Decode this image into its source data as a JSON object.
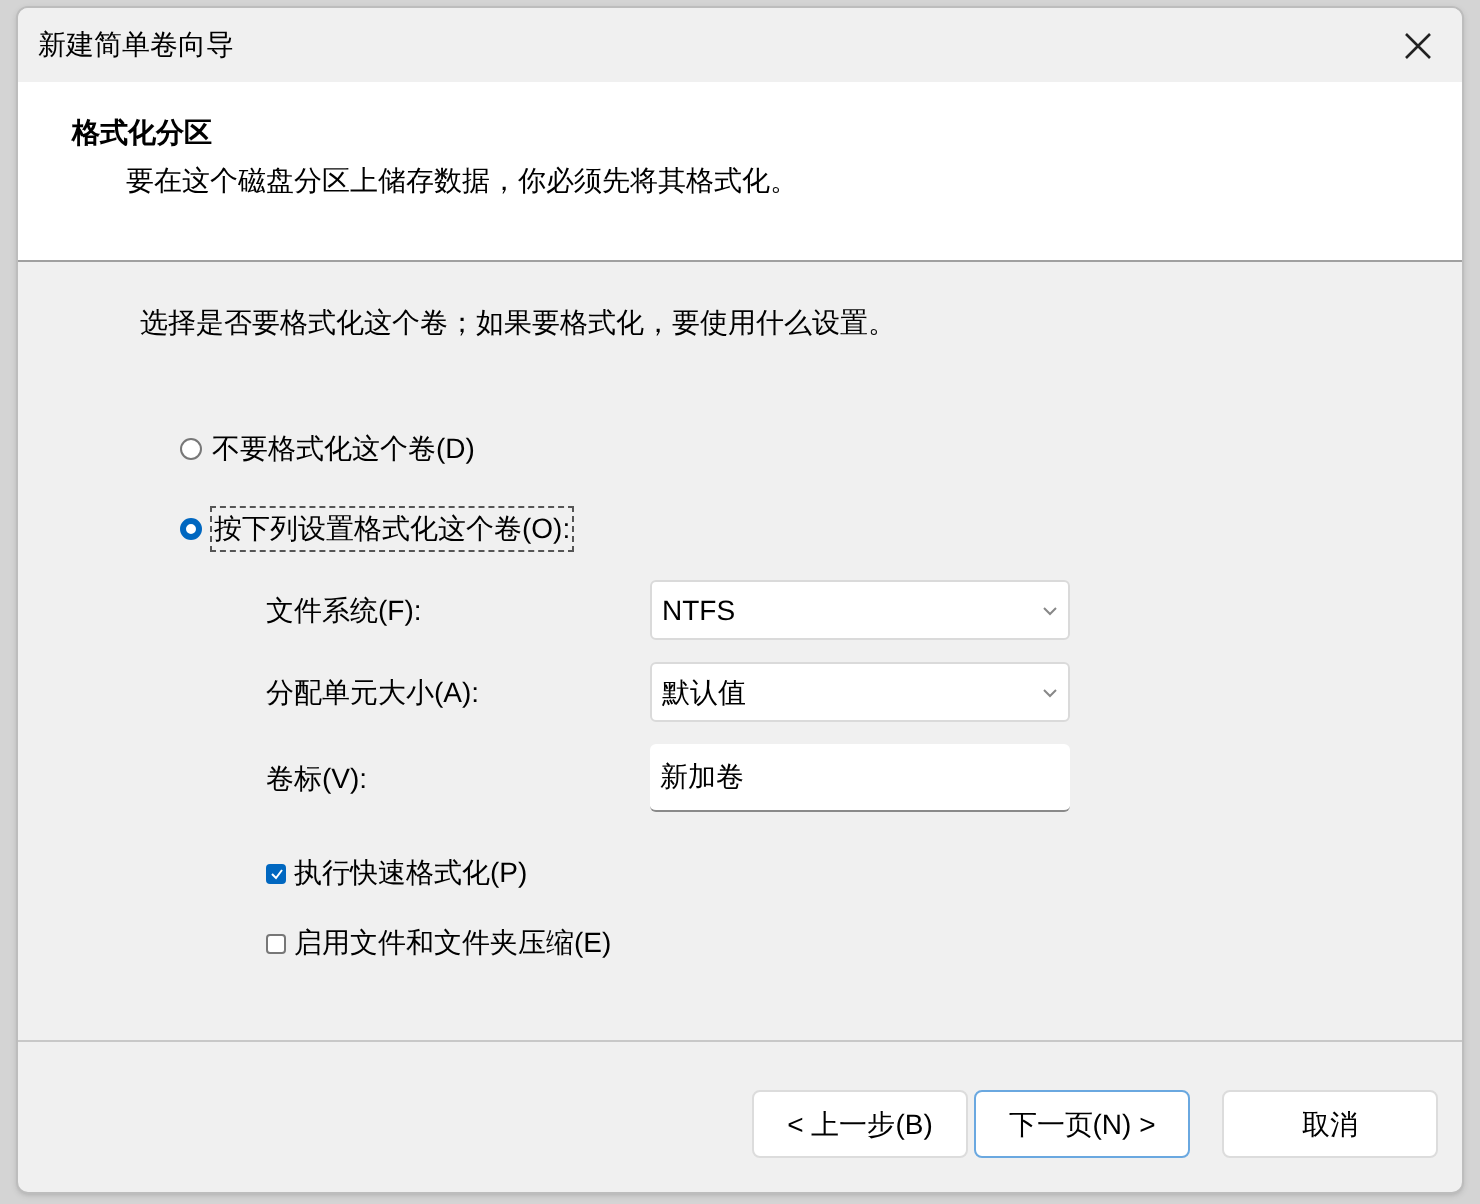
{
  "window": {
    "title": "新建简单卷向导"
  },
  "header": {
    "title": "格式化分区",
    "subtitle": "要在这个磁盘分区上储存数据，你必须先将其格式化。"
  },
  "prompt": "选择是否要格式化这个卷；如果要格式化，要使用什么设置。",
  "options": [
    {
      "label": "不要格式化这个卷(D)",
      "selected": false
    },
    {
      "label": "按下列设置格式化这个卷(O):",
      "selected": true
    }
  ],
  "fields": [
    {
      "kind": "dropdown",
      "label": "文件系统(F):",
      "value": "NTFS"
    },
    {
      "kind": "dropdown",
      "label": "分配单元大小(A):",
      "value": "默认值"
    },
    {
      "kind": "text",
      "label": "卷标(V):",
      "value": "新加卷"
    }
  ],
  "checkboxes": [
    {
      "label": "执行快速格式化(P)",
      "checked": true
    },
    {
      "label": "启用文件和文件夹压缩(E)",
      "checked": false
    }
  ],
  "buttons": [
    {
      "label": "< 上一步(B)",
      "kind": "normal"
    },
    {
      "label": "下一页(N) >",
      "kind": "default"
    },
    {
      "label": "取消",
      "kind": "normal"
    }
  ]
}
